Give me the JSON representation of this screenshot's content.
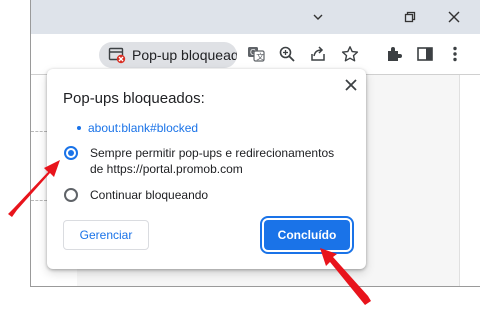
{
  "titlebar": {
    "minimize_glyph": "⌄",
    "restore_glyph": "❐",
    "close_glyph": "✕"
  },
  "toolbar": {
    "popup_chip_label": "Pop-up bloqueado",
    "icons": [
      "popup-blocked-icon",
      "translate-icon",
      "zoom-icon",
      "share-icon",
      "bookmark-star-icon",
      "extensions-icon",
      "side-panel-icon",
      "menu-icon"
    ]
  },
  "popup": {
    "title": "Pop-ups bloqueados:",
    "blocked_link": "about:blank#blocked",
    "option_allow_line1": "Sempre permitir pop-ups e redirecionamentos",
    "option_allow_line2": "de https://portal.promob.com",
    "option_block": "Continuar bloqueando",
    "selected_option": "allow",
    "manage_label": "Gerenciar",
    "done_label": "Concluído"
  },
  "colors": {
    "accent": "#1a73e8",
    "annotation_arrow": "#e8141c"
  }
}
